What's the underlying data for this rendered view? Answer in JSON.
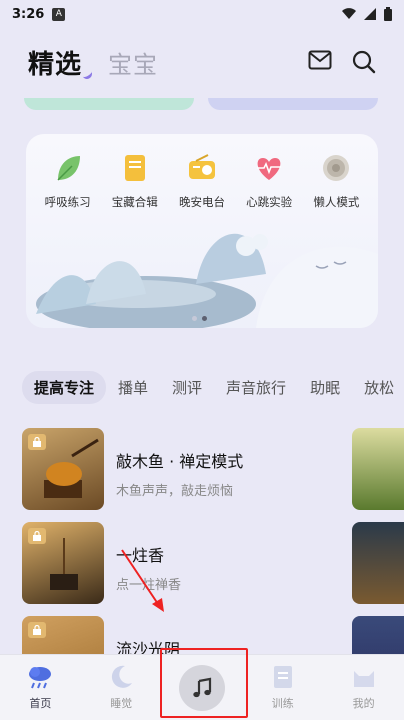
{
  "status_bar": {
    "time": "3:26",
    "badge": "A"
  },
  "header": {
    "tab_active": "精选",
    "tab_inactive": "宝宝"
  },
  "features": [
    {
      "label": "呼吸练习",
      "icon": "leaf-icon"
    },
    {
      "label": "宝藏合辑",
      "icon": "notebook-icon"
    },
    {
      "label": "晚安电台",
      "icon": "radio-icon"
    },
    {
      "label": "心跳实验",
      "icon": "heartbeat-icon"
    },
    {
      "label": "懒人模式",
      "icon": "speaker-icon"
    }
  ],
  "categories": [
    "提高专注",
    "播单",
    "测评",
    "声音旅行",
    "助眠",
    "放松"
  ],
  "list": [
    {
      "title": "敲木鱼 · 禅定模式",
      "subtitle": "木鱼声声，敲走烦恼"
    },
    {
      "title": "一炷香",
      "subtitle": "点一炷禅香"
    },
    {
      "title": "流沙光阴",
      "subtitle": ""
    }
  ],
  "bottom_nav": [
    {
      "label": "首页",
      "icon": "cloud-rain-icon"
    },
    {
      "label": "睡觉",
      "icon": "moon-icon"
    },
    {
      "label": "",
      "icon": "music-note-icon"
    },
    {
      "label": "训练",
      "icon": "checklist-icon"
    },
    {
      "label": "我的",
      "icon": "cat-icon"
    }
  ]
}
